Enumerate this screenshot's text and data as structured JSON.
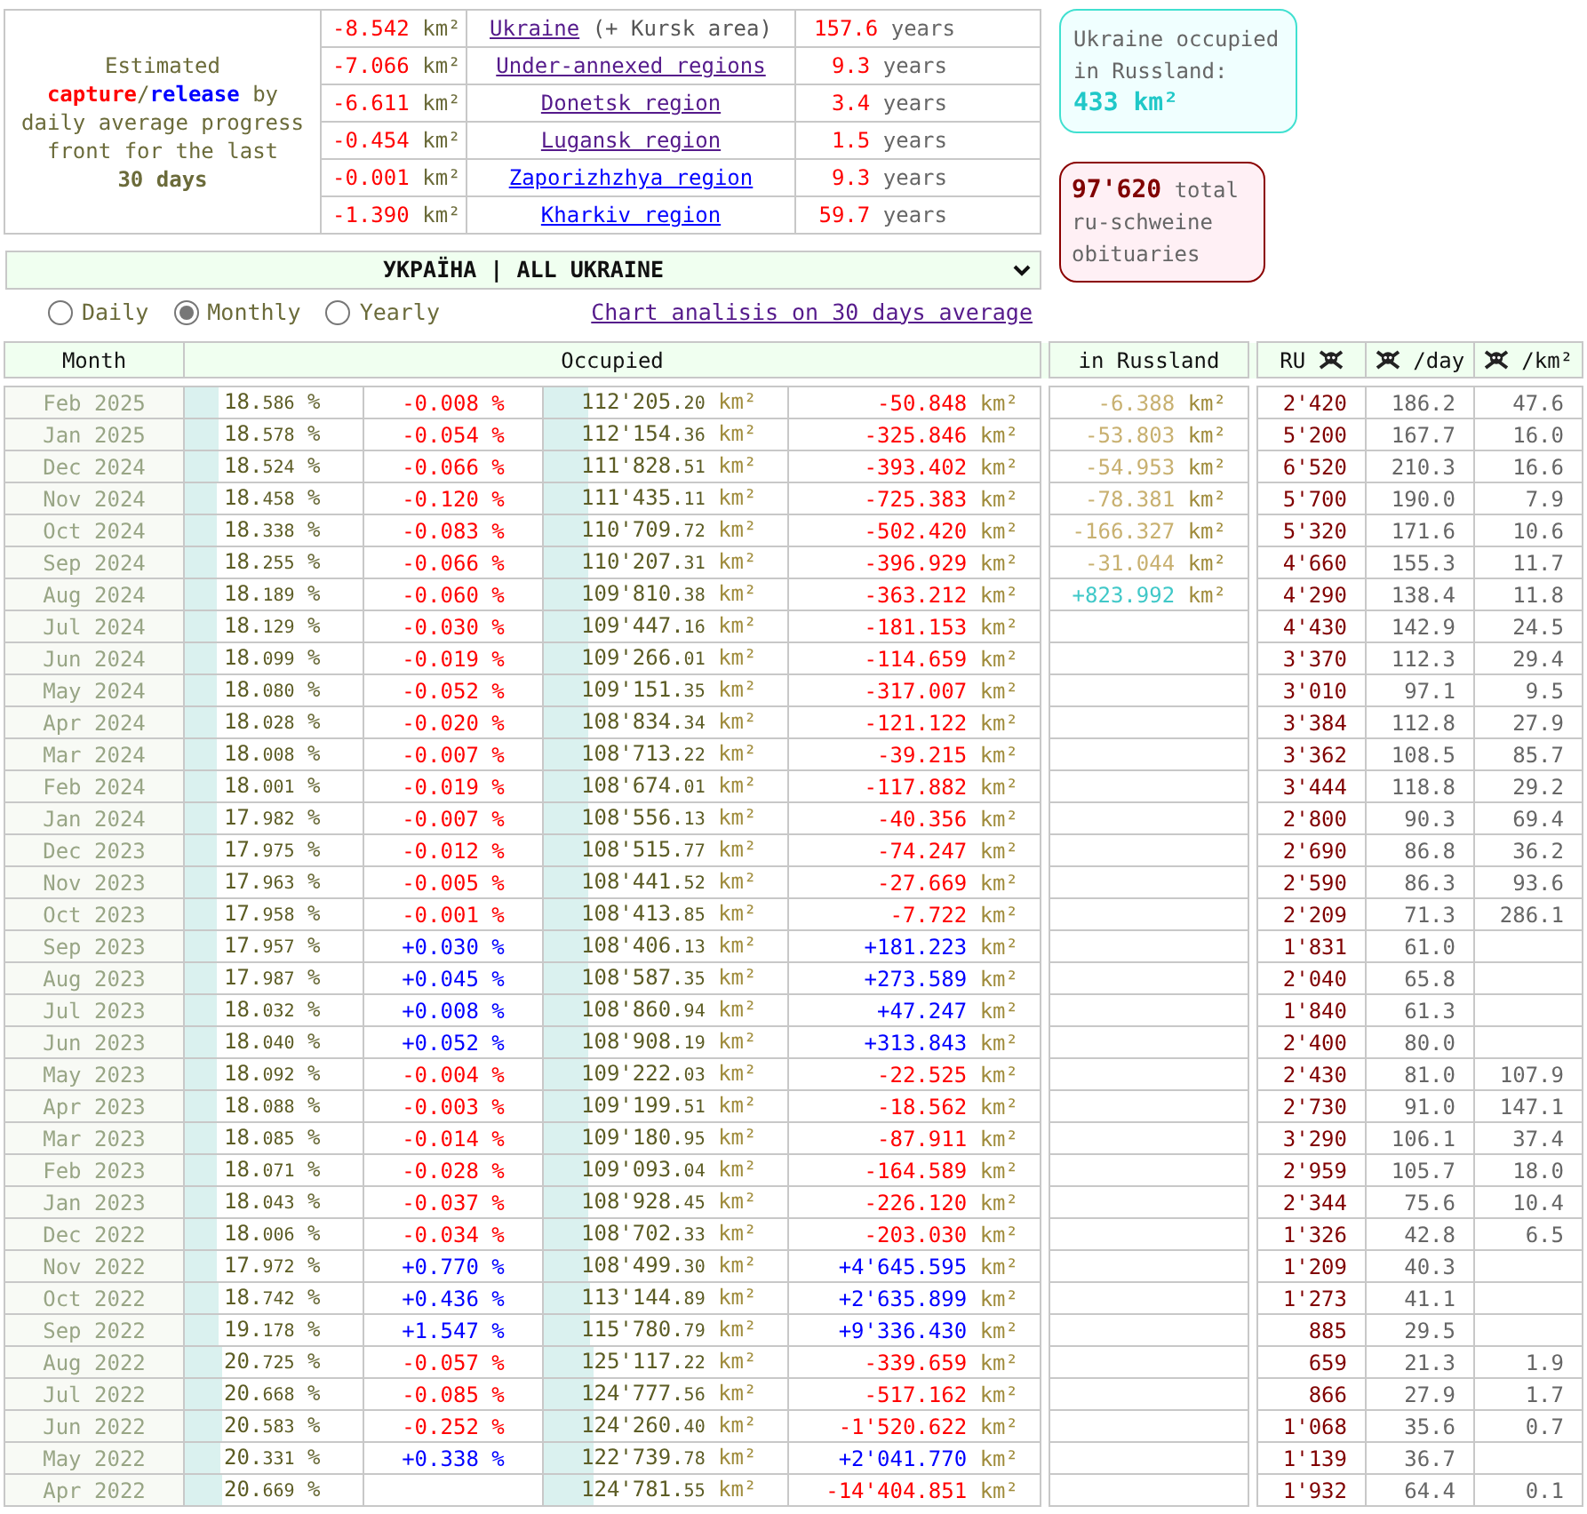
{
  "summary": {
    "description": [
      {
        "kind": "line",
        "text": "Estimated"
      },
      {
        "kind": "capture",
        "text": "capture"
      },
      {
        "kind": "plain",
        "text": "/"
      },
      {
        "kind": "release",
        "text": "release"
      },
      {
        "kind": "plain",
        "text": " by daily average progress front for the last "
      },
      {
        "kind": "strong",
        "text": "30 days"
      }
    ],
    "regions": [
      {
        "change": "-8.542 km²",
        "name": "Ukraine",
        "note": "(+ Kursk area)",
        "visited": true,
        "years": "157.6 years"
      },
      {
        "change": "-7.066 km²",
        "name": "Under-annexed regions",
        "visited": true,
        "years": "9.3 years"
      },
      {
        "change": "-6.611 km²",
        "name": "Donetsk region",
        "visited": true,
        "years": "3.4 years"
      },
      {
        "change": "-0.454 km²",
        "name": "Lugansk region",
        "visited": true,
        "years": "1.5 years"
      },
      {
        "change": "-0.001 km²",
        "name": "Zaporizhzhya region",
        "visited": false,
        "years": "9.3 years"
      },
      {
        "change": "-1.390 km²",
        "name": "Kharkiv region",
        "visited": false,
        "years": "59.7 years"
      }
    ]
  },
  "occupied_box": {
    "label": "Ukraine occupied in Russland:",
    "value": "433 km²"
  },
  "obituaries_box": {
    "value": "97'620",
    "label": "total ru-schweine obituaries"
  },
  "region_select": {
    "value": "УКРАЇНА | ALL UKRAINE"
  },
  "view_modes": [
    {
      "label": "Daily",
      "selected": false
    },
    {
      "label": "Monthly",
      "selected": true
    },
    {
      "label": "Yearly",
      "selected": false
    }
  ],
  "chart_link": {
    "text": "Chart analisis on 30 days average"
  },
  "table": {
    "headers": {
      "month": "Month",
      "occupied": "Occupied",
      "russland": "in Russland",
      "ru": "RU",
      "per_day": "/day",
      "per_km": "/km²"
    },
    "rows": [
      {
        "month": "Feb 2025",
        "pct": "18.586 %",
        "pct_change": "-0.008 %",
        "area": "112'205.20 km²",
        "area_change": "-50.848 km²",
        "gain": false,
        "level": 0.18586,
        "russland": {
          "value": "-6.388 km²",
          "gain": false
        },
        "ru": "2'420",
        "per_day": "186.2",
        "per_km": "47.6"
      },
      {
        "month": "Jan 2025",
        "pct": "18.578 %",
        "pct_change": "-0.054 %",
        "area": "112'154.36 km²",
        "area_change": "-325.846 km²",
        "gain": false,
        "level": 0.18578,
        "russland": {
          "value": "-53.803 km²",
          "gain": false
        },
        "ru": "5'200",
        "per_day": "167.7",
        "per_km": "16.0"
      },
      {
        "month": "Dec 2024",
        "pct": "18.524 %",
        "pct_change": "-0.066 %",
        "area": "111'828.51 km²",
        "area_change": "-393.402 km²",
        "gain": false,
        "level": 0.18524,
        "russland": {
          "value": "-54.953 km²",
          "gain": false
        },
        "ru": "6'520",
        "per_day": "210.3",
        "per_km": "16.6"
      },
      {
        "month": "Nov 2024",
        "pct": "18.458 %",
        "pct_change": "-0.120 %",
        "area": "111'435.11 km²",
        "area_change": "-725.383 km²",
        "gain": false,
        "level": 0.18458,
        "russland": {
          "value": "-78.381 km²",
          "gain": false
        },
        "ru": "5'700",
        "per_day": "190.0",
        "per_km": "7.9"
      },
      {
        "month": "Oct 2024",
        "pct": "18.338 %",
        "pct_change": "-0.083 %",
        "area": "110'709.72 km²",
        "area_change": "-502.420 km²",
        "gain": false,
        "level": 0.18338,
        "russland": {
          "value": "-166.327 km²",
          "gain": false
        },
        "ru": "5'320",
        "per_day": "171.6",
        "per_km": "10.6"
      },
      {
        "month": "Sep 2024",
        "pct": "18.255 %",
        "pct_change": "-0.066 %",
        "area": "110'207.31 km²",
        "area_change": "-396.929 km²",
        "gain": false,
        "level": 0.18255,
        "russland": {
          "value": "-31.044 km²",
          "gain": false
        },
        "ru": "4'660",
        "per_day": "155.3",
        "per_km": "11.7"
      },
      {
        "month": "Aug 2024",
        "pct": "18.189 %",
        "pct_change": "-0.060 %",
        "area": "109'810.38 km²",
        "area_change": "-363.212 km²",
        "gain": false,
        "level": 0.18189,
        "russland": {
          "value": "+823.992 km²",
          "gain": true
        },
        "ru": "4'290",
        "per_day": "138.4",
        "per_km": "11.8"
      },
      {
        "month": "Jul 2024",
        "pct": "18.129 %",
        "pct_change": "-0.030 %",
        "area": "109'447.16 km²",
        "area_change": "-181.153 km²",
        "gain": false,
        "level": 0.18129,
        "ru": "4'430",
        "per_day": "142.9",
        "per_km": "24.5"
      },
      {
        "month": "Jun 2024",
        "pct": "18.099 %",
        "pct_change": "-0.019 %",
        "area": "109'266.01 km²",
        "area_change": "-114.659 km²",
        "gain": false,
        "level": 0.18099,
        "ru": "3'370",
        "per_day": "112.3",
        "per_km": "29.4"
      },
      {
        "month": "May 2024",
        "pct": "18.080 %",
        "pct_change": "-0.052 %",
        "area": "109'151.35 km²",
        "area_change": "-317.007 km²",
        "gain": false,
        "level": 0.1808,
        "ru": "3'010",
        "per_day": "97.1",
        "per_km": "9.5"
      },
      {
        "month": "Apr 2024",
        "pct": "18.028 %",
        "pct_change": "-0.020 %",
        "area": "108'834.34 km²",
        "area_change": "-121.122 km²",
        "gain": false,
        "level": 0.18028,
        "ru": "3'384",
        "per_day": "112.8",
        "per_km": "27.9"
      },
      {
        "month": "Mar 2024",
        "pct": "18.008 %",
        "pct_change": "-0.007 %",
        "area": "108'713.22 km²",
        "area_change": "-39.215 km²",
        "gain": false,
        "level": 0.18008,
        "ru": "3'362",
        "per_day": "108.5",
        "per_km": "85.7"
      },
      {
        "month": "Feb 2024",
        "pct": "18.001 %",
        "pct_change": "-0.019 %",
        "area": "108'674.01 km²",
        "area_change": "-117.882 km²",
        "gain": false,
        "level": 0.18001,
        "ru": "3'444",
        "per_day": "118.8",
        "per_km": "29.2"
      },
      {
        "month": "Jan 2024",
        "pct": "17.982 %",
        "pct_change": "-0.007 %",
        "area": "108'556.13 km²",
        "area_change": "-40.356 km²",
        "gain": false,
        "level": 0.17982,
        "ru": "2'800",
        "per_day": "90.3",
        "per_km": "69.4"
      },
      {
        "month": "Dec 2023",
        "pct": "17.975 %",
        "pct_change": "-0.012 %",
        "area": "108'515.77 km²",
        "area_change": "-74.247 km²",
        "gain": false,
        "level": 0.17975,
        "ru": "2'690",
        "per_day": "86.8",
        "per_km": "36.2"
      },
      {
        "month": "Nov 2023",
        "pct": "17.963 %",
        "pct_change": "-0.005 %",
        "area": "108'441.52 km²",
        "area_change": "-27.669 km²",
        "gain": false,
        "level": 0.17963,
        "ru": "2'590",
        "per_day": "86.3",
        "per_km": "93.6"
      },
      {
        "month": "Oct 2023",
        "pct": "17.958 %",
        "pct_change": "-0.001 %",
        "area": "108'413.85 km²",
        "area_change": "-7.722 km²",
        "gain": false,
        "level": 0.17958,
        "ru": "2'209",
        "per_day": "71.3",
        "per_km": "286.1"
      },
      {
        "month": "Sep 2023",
        "pct": "17.957 %",
        "pct_change": "+0.030 %",
        "area": "108'406.13 km²",
        "area_change": "+181.223 km²",
        "gain": true,
        "level": 0.17957,
        "ru": "1'831",
        "per_day": "61.0"
      },
      {
        "month": "Aug 2023",
        "pct": "17.987 %",
        "pct_change": "+0.045 %",
        "area": "108'587.35 km²",
        "area_change": "+273.589 km²",
        "gain": true,
        "level": 0.17987,
        "ru": "2'040",
        "per_day": "65.8"
      },
      {
        "month": "Jul 2023",
        "pct": "18.032 %",
        "pct_change": "+0.008 %",
        "area": "108'860.94 km²",
        "area_change": "+47.247 km²",
        "gain": true,
        "level": 0.18032,
        "ru": "1'840",
        "per_day": "61.3"
      },
      {
        "month": "Jun 2023",
        "pct": "18.040 %",
        "pct_change": "+0.052 %",
        "area": "108'908.19 km²",
        "area_change": "+313.843 km²",
        "gain": true,
        "level": 0.1804,
        "ru": "2'400",
        "per_day": "80.0"
      },
      {
        "month": "May 2023",
        "pct": "18.092 %",
        "pct_change": "-0.004 %",
        "area": "109'222.03 km²",
        "area_change": "-22.525 km²",
        "gain": false,
        "level": 0.18092,
        "ru": "2'430",
        "per_day": "81.0",
        "per_km": "107.9"
      },
      {
        "month": "Apr 2023",
        "pct": "18.088 %",
        "pct_change": "-0.003 %",
        "area": "109'199.51 km²",
        "area_change": "-18.562 km²",
        "gain": false,
        "level": 0.18088,
        "ru": "2'730",
        "per_day": "91.0",
        "per_km": "147.1"
      },
      {
        "month": "Mar 2023",
        "pct": "18.085 %",
        "pct_change": "-0.014 %",
        "area": "109'180.95 km²",
        "area_change": "-87.911 km²",
        "gain": false,
        "level": 0.18085,
        "ru": "3'290",
        "per_day": "106.1",
        "per_km": "37.4"
      },
      {
        "month": "Feb 2023",
        "pct": "18.071 %",
        "pct_change": "-0.028 %",
        "area": "109'093.04 km²",
        "area_change": "-164.589 km²",
        "gain": false,
        "level": 0.18071,
        "ru": "2'959",
        "per_day": "105.7",
        "per_km": "18.0"
      },
      {
        "month": "Jan 2023",
        "pct": "18.043 %",
        "pct_change": "-0.037 %",
        "area": "108'928.45 km²",
        "area_change": "-226.120 km²",
        "gain": false,
        "level": 0.18043,
        "ru": "2'344",
        "per_day": "75.6",
        "per_km": "10.4"
      },
      {
        "month": "Dec 2022",
        "pct": "18.006 %",
        "pct_change": "-0.034 %",
        "area": "108'702.33 km²",
        "area_change": "-203.030 km²",
        "gain": false,
        "level": 0.18006,
        "ru": "1'326",
        "per_day": "42.8",
        "per_km": "6.5"
      },
      {
        "month": "Nov 2022",
        "pct": "17.972 %",
        "pct_change": "+0.770 %",
        "area": "108'499.30 km²",
        "area_change": "+4'645.595 km²",
        "gain": true,
        "level": 0.17972,
        "ru": "1'209",
        "per_day": "40.3"
      },
      {
        "month": "Oct 2022",
        "pct": "18.742 %",
        "pct_change": "+0.436 %",
        "area": "113'144.89 km²",
        "area_change": "+2'635.899 km²",
        "gain": true,
        "level": 0.18742,
        "ru": "1'273",
        "per_day": "41.1"
      },
      {
        "month": "Sep 2022",
        "pct": "19.178 %",
        "pct_change": "+1.547 %",
        "area": "115'780.79 km²",
        "area_change": "+9'336.430 km²",
        "gain": true,
        "level": 0.19178,
        "ru": "885",
        "per_day": "29.5"
      },
      {
        "month": "Aug 2022",
        "pct": "20.725 %",
        "pct_change": "-0.057 %",
        "area": "125'117.22 km²",
        "area_change": "-339.659 km²",
        "gain": false,
        "level": 0.20725,
        "ru": "659",
        "per_day": "21.3",
        "per_km": "1.9"
      },
      {
        "month": "Jul 2022",
        "pct": "20.668 %",
        "pct_change": "-0.085 %",
        "area": "124'777.56 km²",
        "area_change": "-517.162 km²",
        "gain": false,
        "level": 0.20668,
        "ru": "866",
        "per_day": "27.9",
        "per_km": "1.7"
      },
      {
        "month": "Jun 2022",
        "pct": "20.583 %",
        "pct_change": "-0.252 %",
        "area": "124'260.40 km²",
        "area_change": "-1'520.622 km²",
        "gain": false,
        "level": 0.20583,
        "ru": "1'068",
        "per_day": "35.6",
        "per_km": "0.7"
      },
      {
        "month": "May 2022",
        "pct": "20.331 %",
        "pct_change": "+0.338 %",
        "area": "122'739.78 km²",
        "area_change": "+2'041.770 km²",
        "gain": true,
        "level": 0.20331,
        "ru": "1'139",
        "per_day": "36.7"
      },
      {
        "month": "Apr 2022",
        "pct": "20.669 %",
        "area": "124'781.55 km²",
        "area_change": "-14'404.851 km²",
        "gain": false,
        "level": 0.20669,
        "ru": "1'932",
        "per_day": "64.4",
        "per_km": "0.1"
      }
    ]
  }
}
